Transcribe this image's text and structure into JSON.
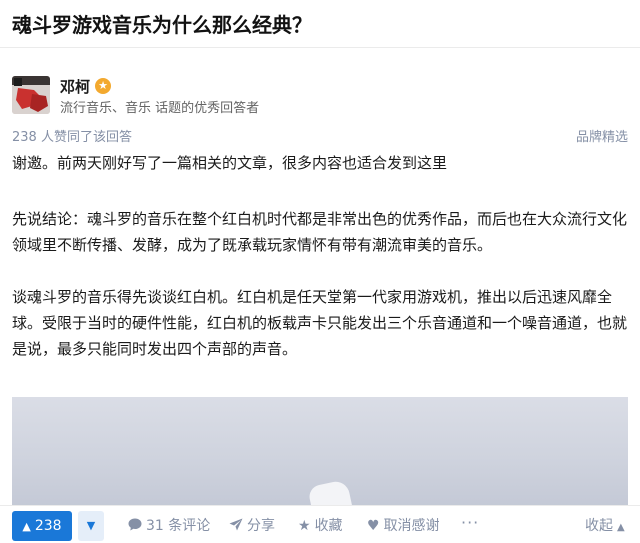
{
  "question": {
    "title": "魂斗罗游戏音乐为什么那么经典？"
  },
  "author": {
    "name": "邓柯",
    "badge_icon": "star-badge",
    "description": "流行音乐、音乐 话题的优秀回答者"
  },
  "answer": {
    "vote_text": "238 人赞同了该回答",
    "brand_label": "品牌精选",
    "paragraphs": [
      "谢邀。前两天刚好写了一篇相关的文章，很多内容也适合发到这里",
      "先说结论：魂斗罗的音乐在整个红白机时代都是非常出色的优秀作品，而后也在大众流行文化领域里不断传播、发酵，成为了既承载玩家情怀有带有潮流审美的音乐。",
      "谈魂斗罗的音乐得先谈谈红白机。红白机是任天堂第一代家用游戏机，推出以后迅速风靡全球。受限于当时的硬件性能，红白机的板载声卡只能发出三个乐音通道和一个噪音通道，也就是说，最多只能同时发出四个声部的声音。"
    ]
  },
  "actions": {
    "upvote_count": "238",
    "comments": "31 条评论",
    "share": "分享",
    "favorite": "收藏",
    "thanks": "取消感谢",
    "more": "···",
    "collapse": "收起"
  },
  "colors": {
    "accent": "#1a78d8",
    "muted": "#8590a6",
    "badge": "#f3a92f"
  }
}
